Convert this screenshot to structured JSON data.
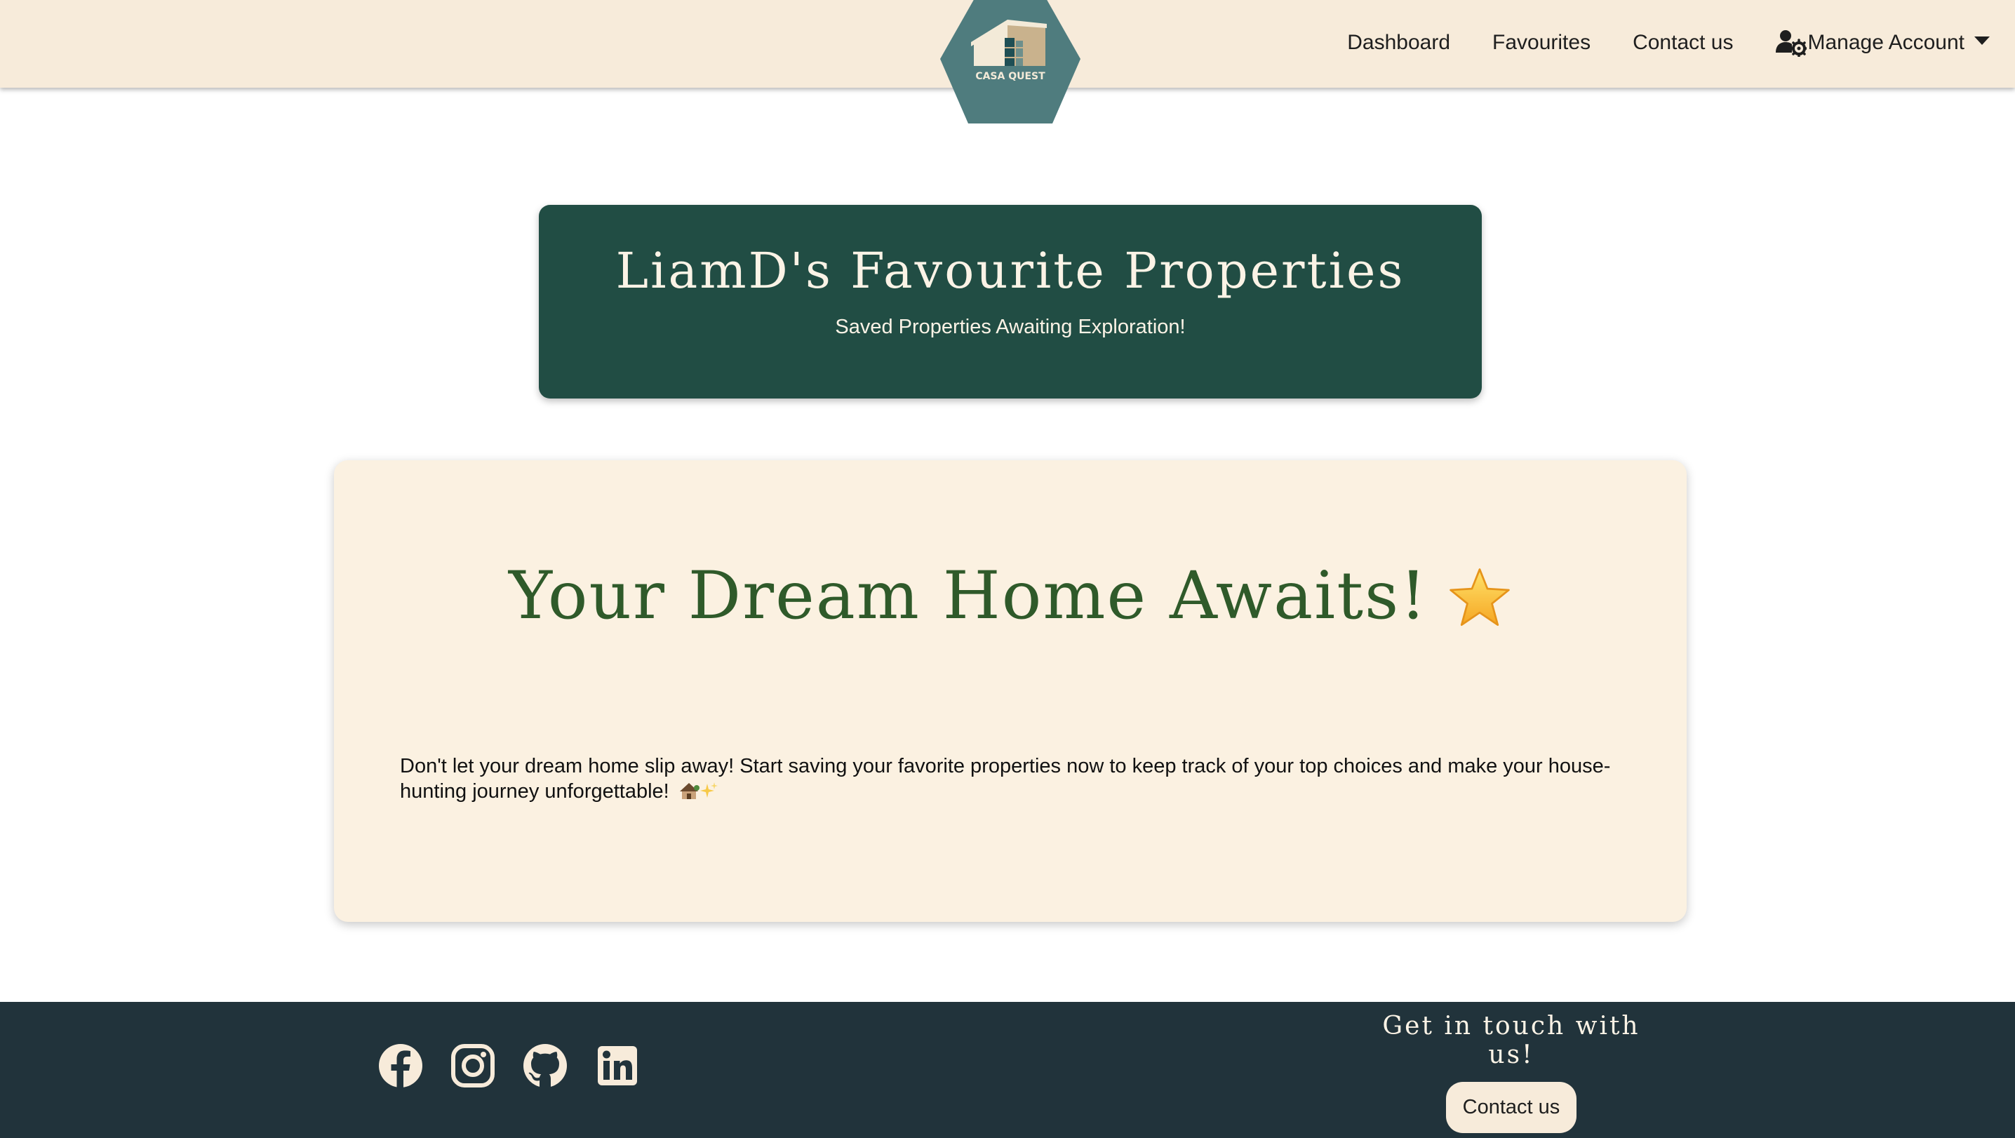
{
  "colors": {
    "navbar_bg": "#f7ebda",
    "header_card_bg": "#214d44",
    "main_card_bg": "#fbf1e1",
    "footer_bg": "#21333b",
    "logo_hex": "#4f7c7e",
    "title_green": "#2f5a2a"
  },
  "nav": {
    "logo_text": "CASA QUEST",
    "links": [
      "Dashboard",
      "Favourites",
      "Contact us"
    ],
    "account_label": "Manage Account",
    "account_icon": "user-gear-icon",
    "dropdown_icon": "caret-down-icon"
  },
  "header": {
    "title": "LiamD's Favourite Properties",
    "subtitle": "Saved Properties Awaiting Exploration!"
  },
  "main": {
    "title": "Your Dream Home Awaits!",
    "title_icon": "star-icon",
    "body": "Don't let your dream home slip away! Start saving your favorite properties now to keep track of your top choices and make your house-hunting journey unforgettable!",
    "body_icons": [
      "house-icon",
      "sparkles-icon"
    ]
  },
  "footer": {
    "social_icons": [
      "facebook-icon",
      "instagram-icon",
      "github-icon",
      "linkedin-icon"
    ],
    "cta_title": "Get in touch with us!",
    "cta_button": "Contact us"
  }
}
